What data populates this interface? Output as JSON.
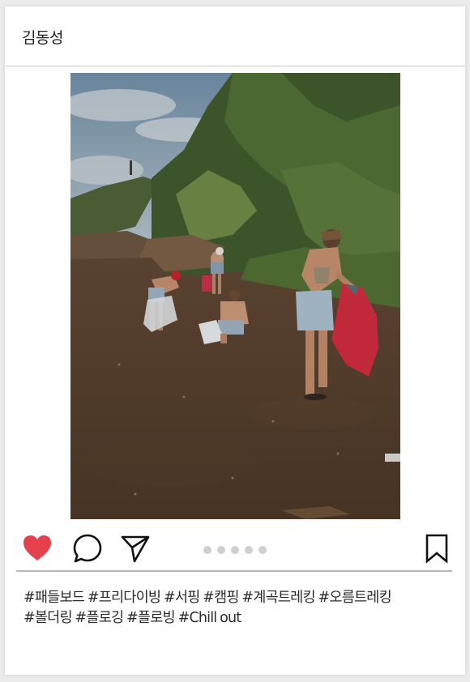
{
  "post": {
    "username": "김동성",
    "image": {
      "description_icon": "beach-cleanup-photo"
    },
    "actions": {
      "like_icon": "heart-icon",
      "comment_icon": "comment-icon",
      "share_icon": "paper-plane-icon",
      "save_icon": "bookmark-icon",
      "liked": true,
      "like_color": "#e5414d",
      "carousel_dot_count": 5
    },
    "hashtags_line1": "#패들보드 #프리다이빙 #서핑 #캠핑 #계곡트레킹 #오름트레킹",
    "hashtags_line2": "#볼더링 #플로깅 #플로빙 #Chill out"
  }
}
